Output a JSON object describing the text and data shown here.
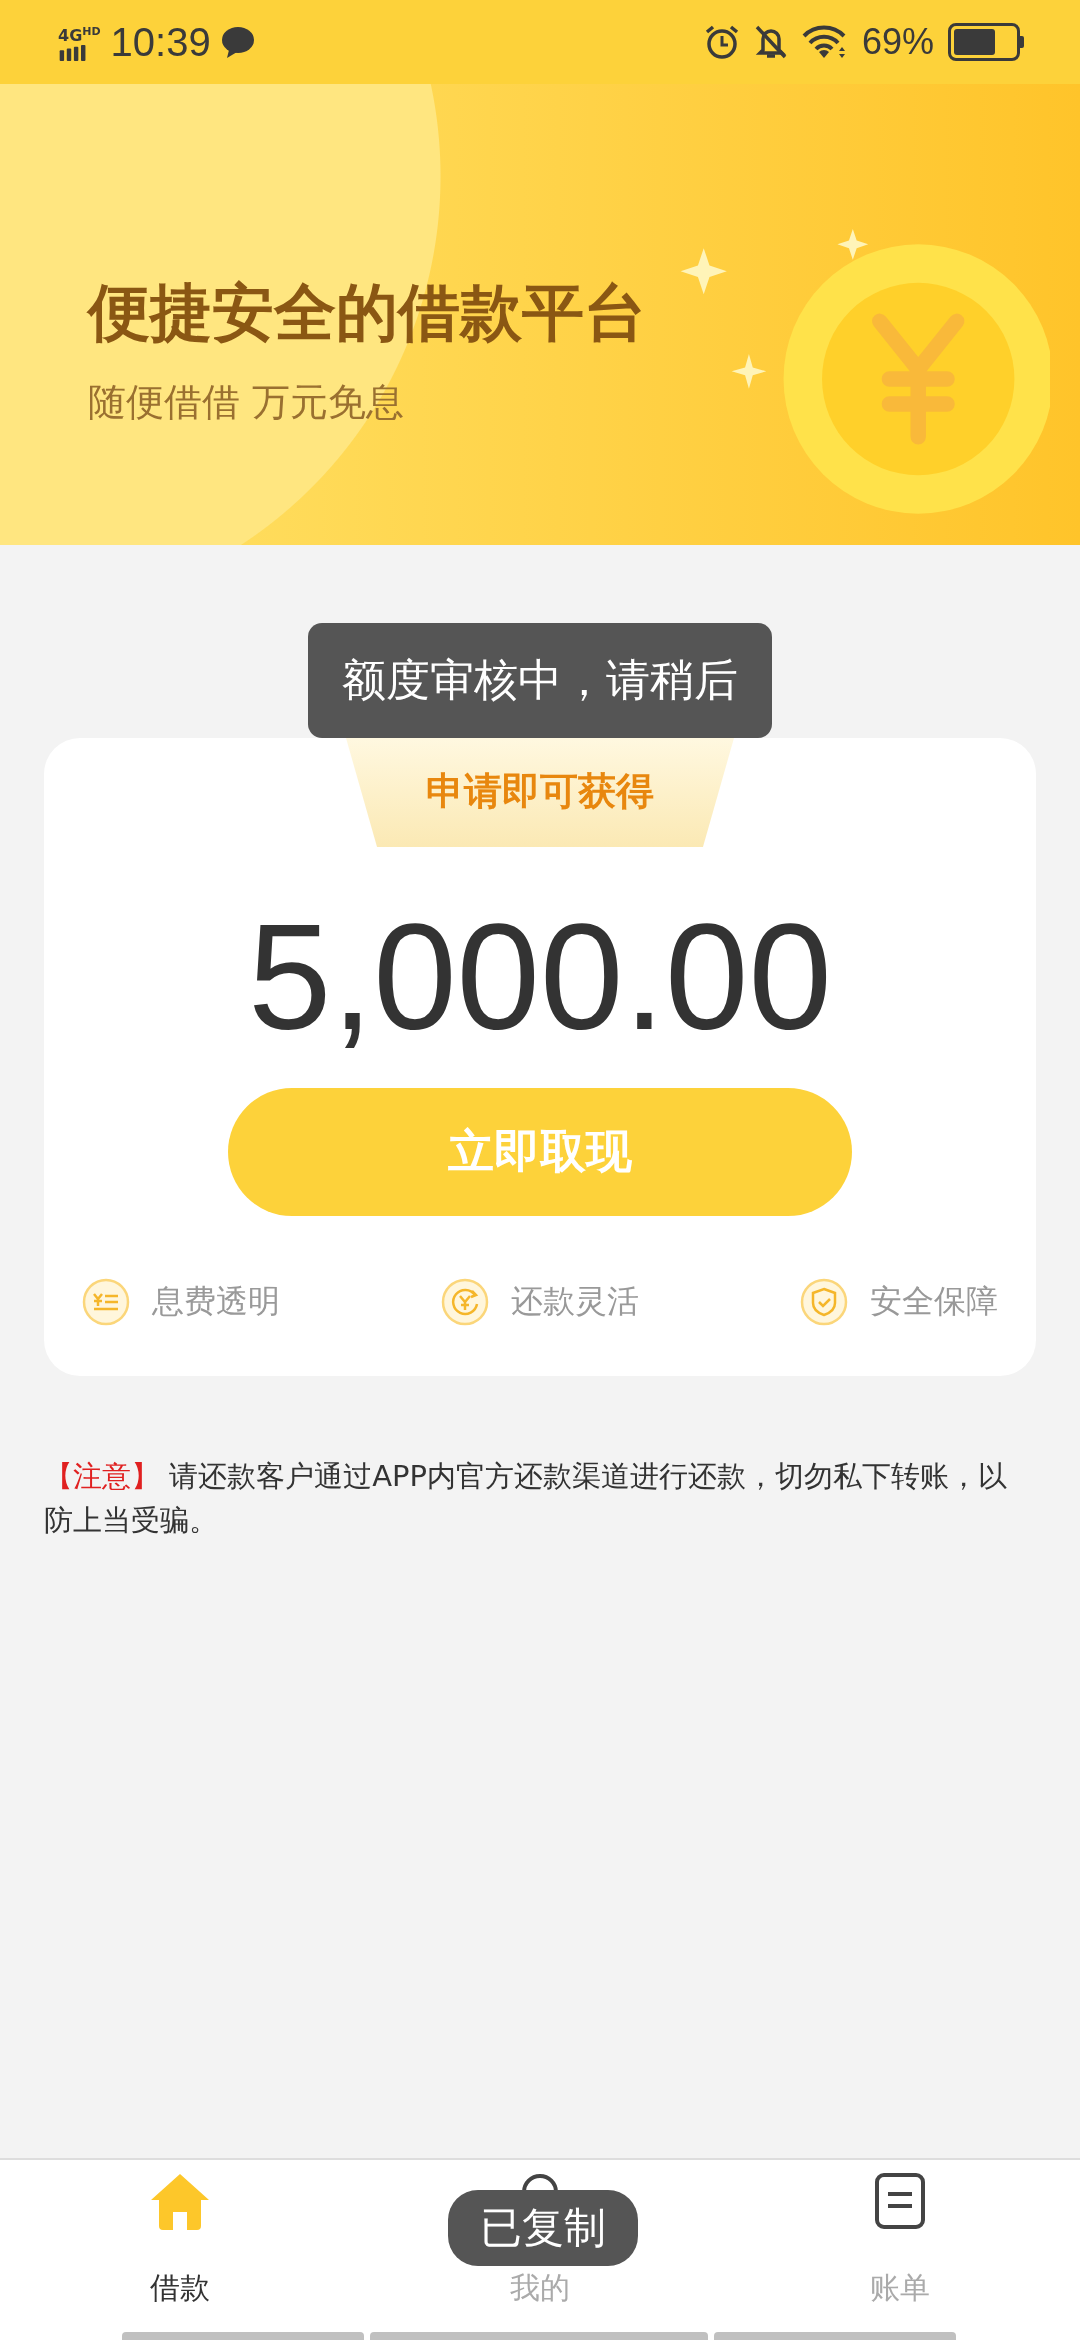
{
  "status_bar": {
    "network": "4G",
    "network_sub": "HD",
    "time": "10:39",
    "battery": "69%"
  },
  "banner": {
    "title": "便捷安全的借款平台",
    "subtitle": "随便借借 万元免息"
  },
  "review_toast": "额度审核中，请稍后",
  "card": {
    "tag": "申请即可获得",
    "amount": "5,000.00",
    "button": "立即取现",
    "features": [
      {
        "kind": "fee",
        "label": "息费透明"
      },
      {
        "kind": "repay",
        "label": "还款灵活"
      },
      {
        "kind": "shield",
        "label": "安全保障"
      }
    ]
  },
  "notice": {
    "label": "【注意】",
    "text": "请还款客户通过APP内官方还款渠道进行还款，切勿私下转账，以防上当受骗。"
  },
  "tab_bar": [
    {
      "kind": "home",
      "label": "借款",
      "selected": true
    },
    {
      "kind": "profile",
      "label": "我的",
      "selected": false
    },
    {
      "kind": "bill",
      "label": "账单",
      "selected": false
    }
  ],
  "copied_toast": "已复制"
}
